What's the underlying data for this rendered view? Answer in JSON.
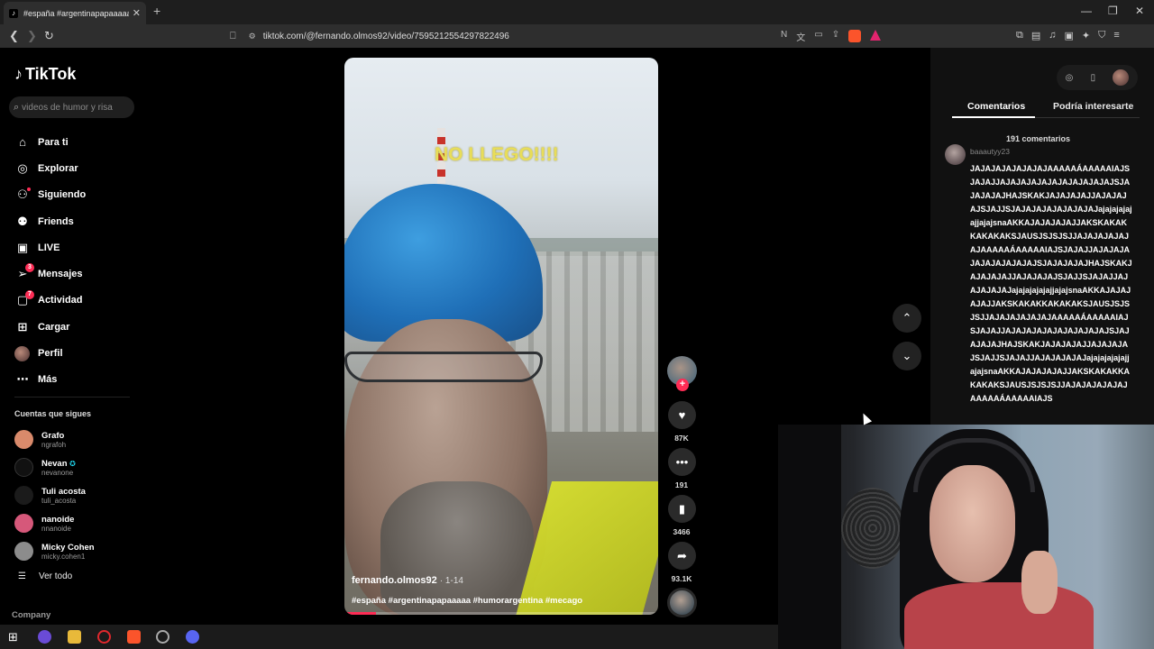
{
  "browser": {
    "tab_title": "#españa #argentinapapaaaaa #h",
    "url": "tiktok.com/@fernando.olmos92/video/7595212554297822496"
  },
  "tiktok": {
    "logo": "TikTok",
    "search_placeholder": "videos de humor y risa",
    "nav": [
      {
        "label": "Para ti",
        "icon": "home-icon"
      },
      {
        "label": "Explorar",
        "icon": "compass-icon"
      },
      {
        "label": "Siguiendo",
        "icon": "following-icon"
      },
      {
        "label": "Friends",
        "icon": "friends-icon"
      },
      {
        "label": "LIVE",
        "icon": "live-icon"
      },
      {
        "label": "Mensajes",
        "icon": "messages-icon",
        "badge": "3"
      },
      {
        "label": "Actividad",
        "icon": "activity-icon",
        "badge": "7"
      },
      {
        "label": "Cargar",
        "icon": "upload-icon"
      },
      {
        "label": "Perfil",
        "icon": "profile-avatar"
      },
      {
        "label": "Más",
        "icon": "more-icon"
      }
    ],
    "following_title": "Cuentas que sigues",
    "following": [
      {
        "name": "Grafo",
        "handle": "ngrafoh",
        "color": "#d98a6b"
      },
      {
        "name": "Nevan",
        "handle": "nevanone",
        "color": "#111111"
      },
      {
        "name": "Tuli acosta",
        "handle": "tuli_acosta",
        "color": "#1b1b1b"
      },
      {
        "name": "nanoide",
        "handle": "nnanoide",
        "color": "#d6587a"
      },
      {
        "name": "Micky Cohen",
        "handle": "micky.cohen1",
        "color": "#8c8c8c"
      }
    ],
    "see_all": "Ver todo",
    "company": "Company"
  },
  "video": {
    "overlay_text": "NO LLEGO!!!!",
    "author": "fernando.olmos92",
    "date": "1-14",
    "tags": "#españa #argentinapapaaaaa #humorargentina #mecago",
    "progress": 0.1
  },
  "actions": {
    "likes": "87K",
    "comments": "191",
    "saves": "3466",
    "shares": "93.1K"
  },
  "comments_panel": {
    "tab_comments": "Comentarios",
    "tab_related": "Podría interesarte",
    "count": "191 comentarios",
    "first_user": "baaautyy23",
    "first_text": "JAJAJAJAJAJAJAJAAAAAÁAAAAAIAJSJAJAJJAJAJAJAJAJAJAJAJAJAJAJSJAJAJAJAJHAJSKAKJAJAJAJAJJAJAJAJAJSJAJJSJAJAJAJAJAJAJAJAJajajajajajajjajajsnaAKKAJAJAJAJAJJAKSKAKAKKAKAKAKSJAUSJSJSJSJJAJAJAJAJAJAJAAAAAÁAAAAAIAJSJAJAJJAJAJAJAJAJAJAJAJAJAJSJAJAJAJAJHAJSKAKJAJAJAJAJJAJAJAJAJSJAJJSJAJAJJAJAJAJAJAJajajajajajajjajajsnaAKKAJAJAJAJAJJAKSKAKAKKAKAKAKSJAUSJSJSJSJJAJAJAJAJAJAJAAAAAÁAAAAAIAJSJAJAJJAJAJAJAJAJAJAJAJAJAJSJAJAJAJAJHAJSKAKJAJAJAJAJJAJAJAJAJSJAJJSJAJAJJAJAJAJAJAJajajajajajajjajajsnaAKKAJAJAJAJAJJAKSKAKAKKAKAKAKSJAUSJSJSJSJJAJAJAJAJAJAJAAAAAÁAAAAAIAJS"
  }
}
